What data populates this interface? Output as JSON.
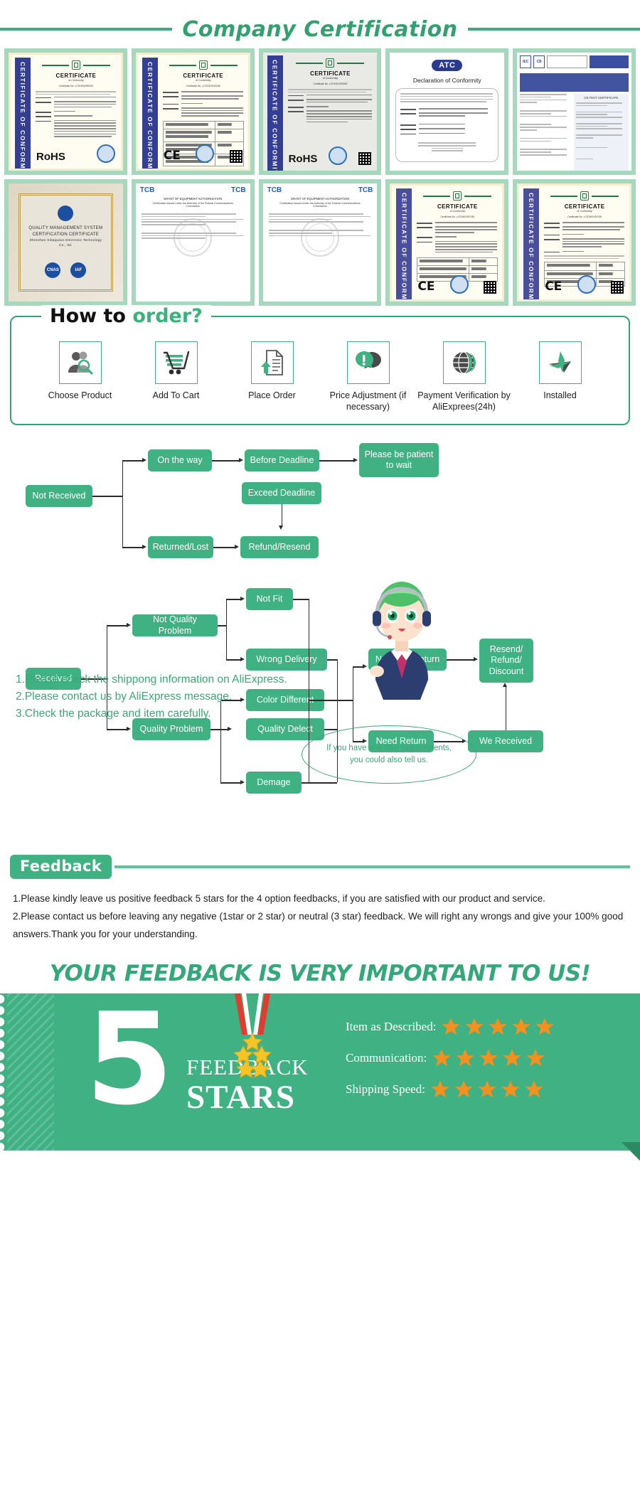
{
  "certification": {
    "title": "Company Certification",
    "cards": [
      {
        "kind": "certificate",
        "band": "CERTIFICATE OF CONFORMITY",
        "heading": "CERTIFICATE",
        "sub": "of Conformity",
        "ref": "Certificate No. LCS1901090043",
        "mark": "RoHS"
      },
      {
        "kind": "certificate-table",
        "band": "CERTIFICATE OF CONFORMITY",
        "heading": "CERTIFICATE",
        "sub": "of Conformity",
        "ref": "Certificate No. LCS1901090038",
        "mark": "CE"
      },
      {
        "kind": "certificate",
        "band": "CERTIFICATE OF CONFORMITY",
        "heading": "CERTIFICATE",
        "sub": "of Conformity",
        "ref": "Certificate No. LCS1901090030",
        "mark": "RoHS"
      },
      {
        "kind": "atc",
        "badge": "ATC",
        "heading": "Declaration of Conformity"
      },
      {
        "kind": "cb",
        "logo": "IEC",
        "heading": "CB TEST CERTIFICATE"
      },
      {
        "kind": "qms",
        "heading": "QUALITY MANAGEMENT SYSTEM",
        "heading2": "CERTIFICATION CERTIFICATE",
        "company": "Shenzhen Sibaipulun Electronic Technology",
        "company2": "Co., ltd.",
        "badge1": "CNAS",
        "badge2": "IAF"
      },
      {
        "kind": "tcb",
        "logo": "TCB",
        "heading": "GRANT OF EQUIPMENT AUTHORIZATION",
        "sub": "Certification Issued Under the Authority of the Federal Communications Commission"
      },
      {
        "kind": "tcb",
        "logo": "TCB",
        "heading": "GRANT OF EQUIPMENT AUTHORIZATION",
        "sub": "Certification Issued Under the Authority of the Federal Communications Commission"
      },
      {
        "kind": "certificate",
        "band": "CERTIFICATE OF CONFORMITY",
        "heading": "CERTIFICATE",
        "sub": "of Conformity",
        "ref": "Certificate No. LCS1901097030",
        "mark": "CE"
      },
      {
        "kind": "certificate",
        "band": "CERTIFICATE OF CONFORMITY",
        "heading": "CERTIFICATE",
        "sub": "of Conformity",
        "ref": "Certificate No. LCS1901097035",
        "mark": "CE"
      }
    ]
  },
  "how_to_order": {
    "title_black": "How to ",
    "title_green": "order?",
    "steps": [
      {
        "icon": "person-search-icon",
        "label": "Choose Product"
      },
      {
        "icon": "shopping-cart-icon",
        "label": "Add To Cart"
      },
      {
        "icon": "document-upload-icon",
        "label": "Place Order"
      },
      {
        "icon": "chat-alert-icon",
        "label": "Price Adjustment\n(if necessary)"
      },
      {
        "icon": "globe-icon",
        "label": "Payment Verification\nby AliExprees(24h)"
      },
      {
        "icon": "airplane-icon",
        "label": "Installed"
      }
    ]
  },
  "flow_not_received": {
    "nodes": {
      "root": "Not Received",
      "on_the_way": "On the way",
      "before_deadline": "Before Deadline",
      "please_wait": "Please be patient\nto wait",
      "exceed_deadline": "Exceed Deadline",
      "returned_lost": "Returned/Lost",
      "refund_resend": "Refund/Resend"
    }
  },
  "flow_received": {
    "nodes": {
      "root": "Received",
      "not_quality": "Not Quality Problem",
      "quality": "Quality Problem",
      "not_fit": "Not Fit",
      "wrong_delivery": "Wrong Delivery",
      "color_different": "Color Different",
      "quality_delect": "Quality Delect",
      "demage": "Demage",
      "no_need_return": "No Need Return",
      "need_return": "Need Return",
      "resend_refund": "Resend/\nRefund/\nDiscount",
      "we_received": "We Received"
    }
  },
  "notes": {
    "line1": "1.Please check the shippong information on AliExpress.",
    "line2": "2.Please contact us by AliExpress message.",
    "line3": "3.Check the package and item carefully.",
    "bubble1": "If you have any else requirements,",
    "bubble2": "you could also tell us."
  },
  "feedback": {
    "tag": "Feedback",
    "p1": "1.Please kindly leave us positive feedback 5 stars for the 4 option feedbacks, if you are satisfied with our product and service.",
    "p2": "2.Please contact us before leaving any negative (1star or 2 star) or neutral (3 star) feedback. We will right any wrongs and give your 100% good answers.Thank you for your understanding.",
    "banner": "YOUR FEEDBACK IS VERY IMPORTANT TO US!",
    "big_number": "5",
    "word_feedback": "FEEDBACK",
    "word_stars": "STARS",
    "ratings": [
      {
        "label": "Item as Described:",
        "stars": 5
      },
      {
        "label": "Communication:",
        "stars": 5
      },
      {
        "label": "Shipping Speed:",
        "stars": 5
      }
    ]
  },
  "colors": {
    "brand_green": "#3fb183",
    "title_green": "#32a06f",
    "cert_cell_bg": "#a6d8bd",
    "star_orange": "#f5901e",
    "band_blue": "#343f93"
  }
}
